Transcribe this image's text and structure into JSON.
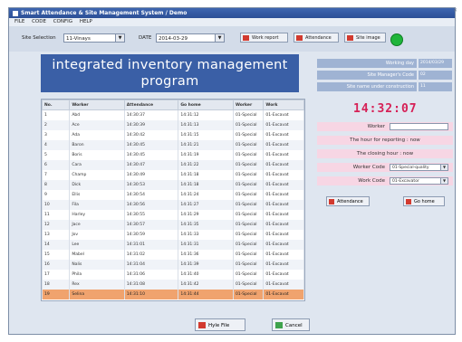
{
  "window": {
    "title": "Smart Attendance & Site Management System  / Demo"
  },
  "menu": [
    "FILE",
    "CODE",
    "CONFIG",
    "HELP"
  ],
  "toolbar": {
    "site_label": "Site Selection",
    "site_value": "11-Vinays",
    "date_label": "DATE",
    "date_value": "2014-03-29",
    "buttons": [
      "Work report",
      "Attendance",
      "Site image"
    ],
    "status_color": "#1fb53a"
  },
  "banner": {
    "line1": "integrated inventory management",
    "line2": "program"
  },
  "grid": {
    "columns": [
      "No.",
      "Worker",
      "Attendance",
      "Go home",
      "Worker",
      "Work"
    ],
    "rows": [
      [
        "1",
        "Abd",
        "14:30:37",
        "14:31:12",
        "01-Special",
        "01-Excavat"
      ],
      [
        "2",
        "Ace",
        "14:30:39",
        "14:31:13",
        "01-Special",
        "01-Excavat"
      ],
      [
        "3",
        "Ada",
        "14:30:42",
        "14:31:15",
        "01-Special",
        "01-Excavat"
      ],
      [
        "4",
        "Baron",
        "14:30:45",
        "14:31:21",
        "01-Special",
        "01-Excavat"
      ],
      [
        "5",
        "Boris",
        "14:30:45",
        "14:31:19",
        "01-Special",
        "01-Excavat"
      ],
      [
        "6",
        "Cara",
        "14:30:47",
        "14:31:22",
        "01-Special",
        "01-Excavat"
      ],
      [
        "7",
        "Champ",
        "14:30:49",
        "14:31:18",
        "01-Special",
        "01-Excavat"
      ],
      [
        "8",
        "Dick",
        "14:30:53",
        "14:31:18",
        "01-Special",
        "01-Excavat"
      ],
      [
        "9",
        "Ellis",
        "14:30:54",
        "14:31:24",
        "01-Special",
        "01-Excavat"
      ],
      [
        "10",
        "Fila",
        "14:30:56",
        "14:31:27",
        "01-Special",
        "01-Excavat"
      ],
      [
        "11",
        "Harley",
        "14:30:55",
        "14:31:29",
        "01-Special",
        "01-Excavat"
      ],
      [
        "12",
        "Jace",
        "14:30:57",
        "14:31:35",
        "01-Special",
        "01-Excavat"
      ],
      [
        "13",
        "Jov",
        "14:30:59",
        "14:31:33",
        "01-Special",
        "01-Excavat"
      ],
      [
        "14",
        "Lee",
        "14:31:01",
        "14:31:31",
        "01-Special",
        "01-Excavat"
      ],
      [
        "15",
        "Mabel",
        "14:31:02",
        "14:31:36",
        "01-Special",
        "01-Excavat"
      ],
      [
        "16",
        "Nalis",
        "14:31:04",
        "14:31:39",
        "01-Special",
        "01-Excavat"
      ],
      [
        "17",
        "Phila",
        "14:31:06",
        "14:31:40",
        "01-Special",
        "01-Excavat"
      ],
      [
        "18",
        "Rex",
        "14:31:08",
        "14:31:42",
        "01-Special",
        "01-Excavat"
      ],
      [
        "19",
        "Selina",
        "14:31:10",
        "14:31:44",
        "01-Special",
        "01-Excavat"
      ]
    ],
    "selected_row": 18
  },
  "bottom_buttons": {
    "file": "Hyle File",
    "cancel": "Cancel"
  },
  "info": {
    "working_day_label": "Working day",
    "working_day_value": "2014/03/29",
    "manager_code_label": "Site Manager's Code",
    "manager_code_value": "02",
    "site_name_label": "Site name under construction",
    "site_name_value": "11"
  },
  "clock": "14:32:07",
  "worker_label": "Worker",
  "messages": {
    "reporting": "The hour for reporting : now",
    "closing": "The closing hour : now"
  },
  "worker_code": {
    "label": "Worker Code",
    "value": "01-Special-quality"
  },
  "work_code": {
    "label": "Work Code",
    "value": "01-Excavator"
  },
  "right_buttons": {
    "attendance": "Attendance",
    "go_home": "Go home"
  }
}
